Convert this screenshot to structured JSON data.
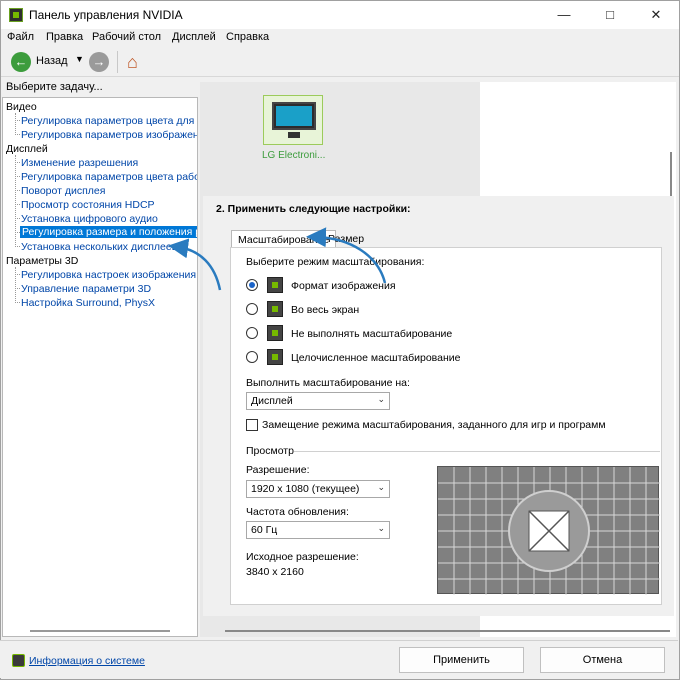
{
  "window": {
    "title": "Панель управления NVIDIA"
  },
  "menu": [
    "Файл",
    "Правка",
    "Рабочий стол",
    "Дисплей",
    "Справка"
  ],
  "toolbar": {
    "back_label": "Назад"
  },
  "tasks": {
    "header": "Выберите задачу...",
    "categories": [
      {
        "label": "Видео",
        "items": [
          "Регулировка параметров цвета для ви",
          "Регулировка параметров изображения"
        ]
      },
      {
        "label": "Дисплей",
        "items": [
          "Изменение разрешения",
          "Регулировка параметров цвета рабоч",
          "Поворот дисплея",
          "Просмотр состояния HDCP",
          "Установка цифрового аудио",
          "Регулировка размера и положения раб",
          "Установка нескольких дисплеев"
        ]
      },
      {
        "label": "Параметры 3D",
        "items": [
          "Регулировка настроек изображения с",
          "Управление параметри 3D",
          "Настройка Surround, PhysX"
        ]
      }
    ],
    "selected_item": "Регулировка размера и положения раб"
  },
  "display": {
    "name": "LG Electroni..."
  },
  "section": {
    "heading": "2. Применить следующие настройки:",
    "tabs": [
      "Масштабирование",
      "Размер"
    ],
    "mode_label": "Выберите режим масштабирования:",
    "modes": [
      "Формат изображения",
      "Во весь экран",
      "Не выполнять масштабирование",
      "Целочисленное масштабирование"
    ],
    "selected_mode": "Формат изображения",
    "perform_on_label": "Выполнить масштабирование на:",
    "perform_on_value": "Дисплей",
    "override_label": "Замещение режима масштабирования, заданного для игр и программ",
    "override_checked": false,
    "preview_label": "Просмотр",
    "resolution_label": "Разрешение:",
    "resolution_value": "1920 x 1080 (текущее)",
    "refresh_label": "Частота обновления:",
    "refresh_value": "60 Гц",
    "native_label": "Исходное разрешение:",
    "native_value": "3840 x 2160"
  },
  "footer": {
    "system_info_link": "Информация о системе",
    "apply_label": "Применить",
    "cancel_label": "Отмена"
  },
  "colors": {
    "accent": "#0078d7",
    "nvidia_green": "#76b900",
    "annotation_arrow": "#2a7bbf"
  }
}
